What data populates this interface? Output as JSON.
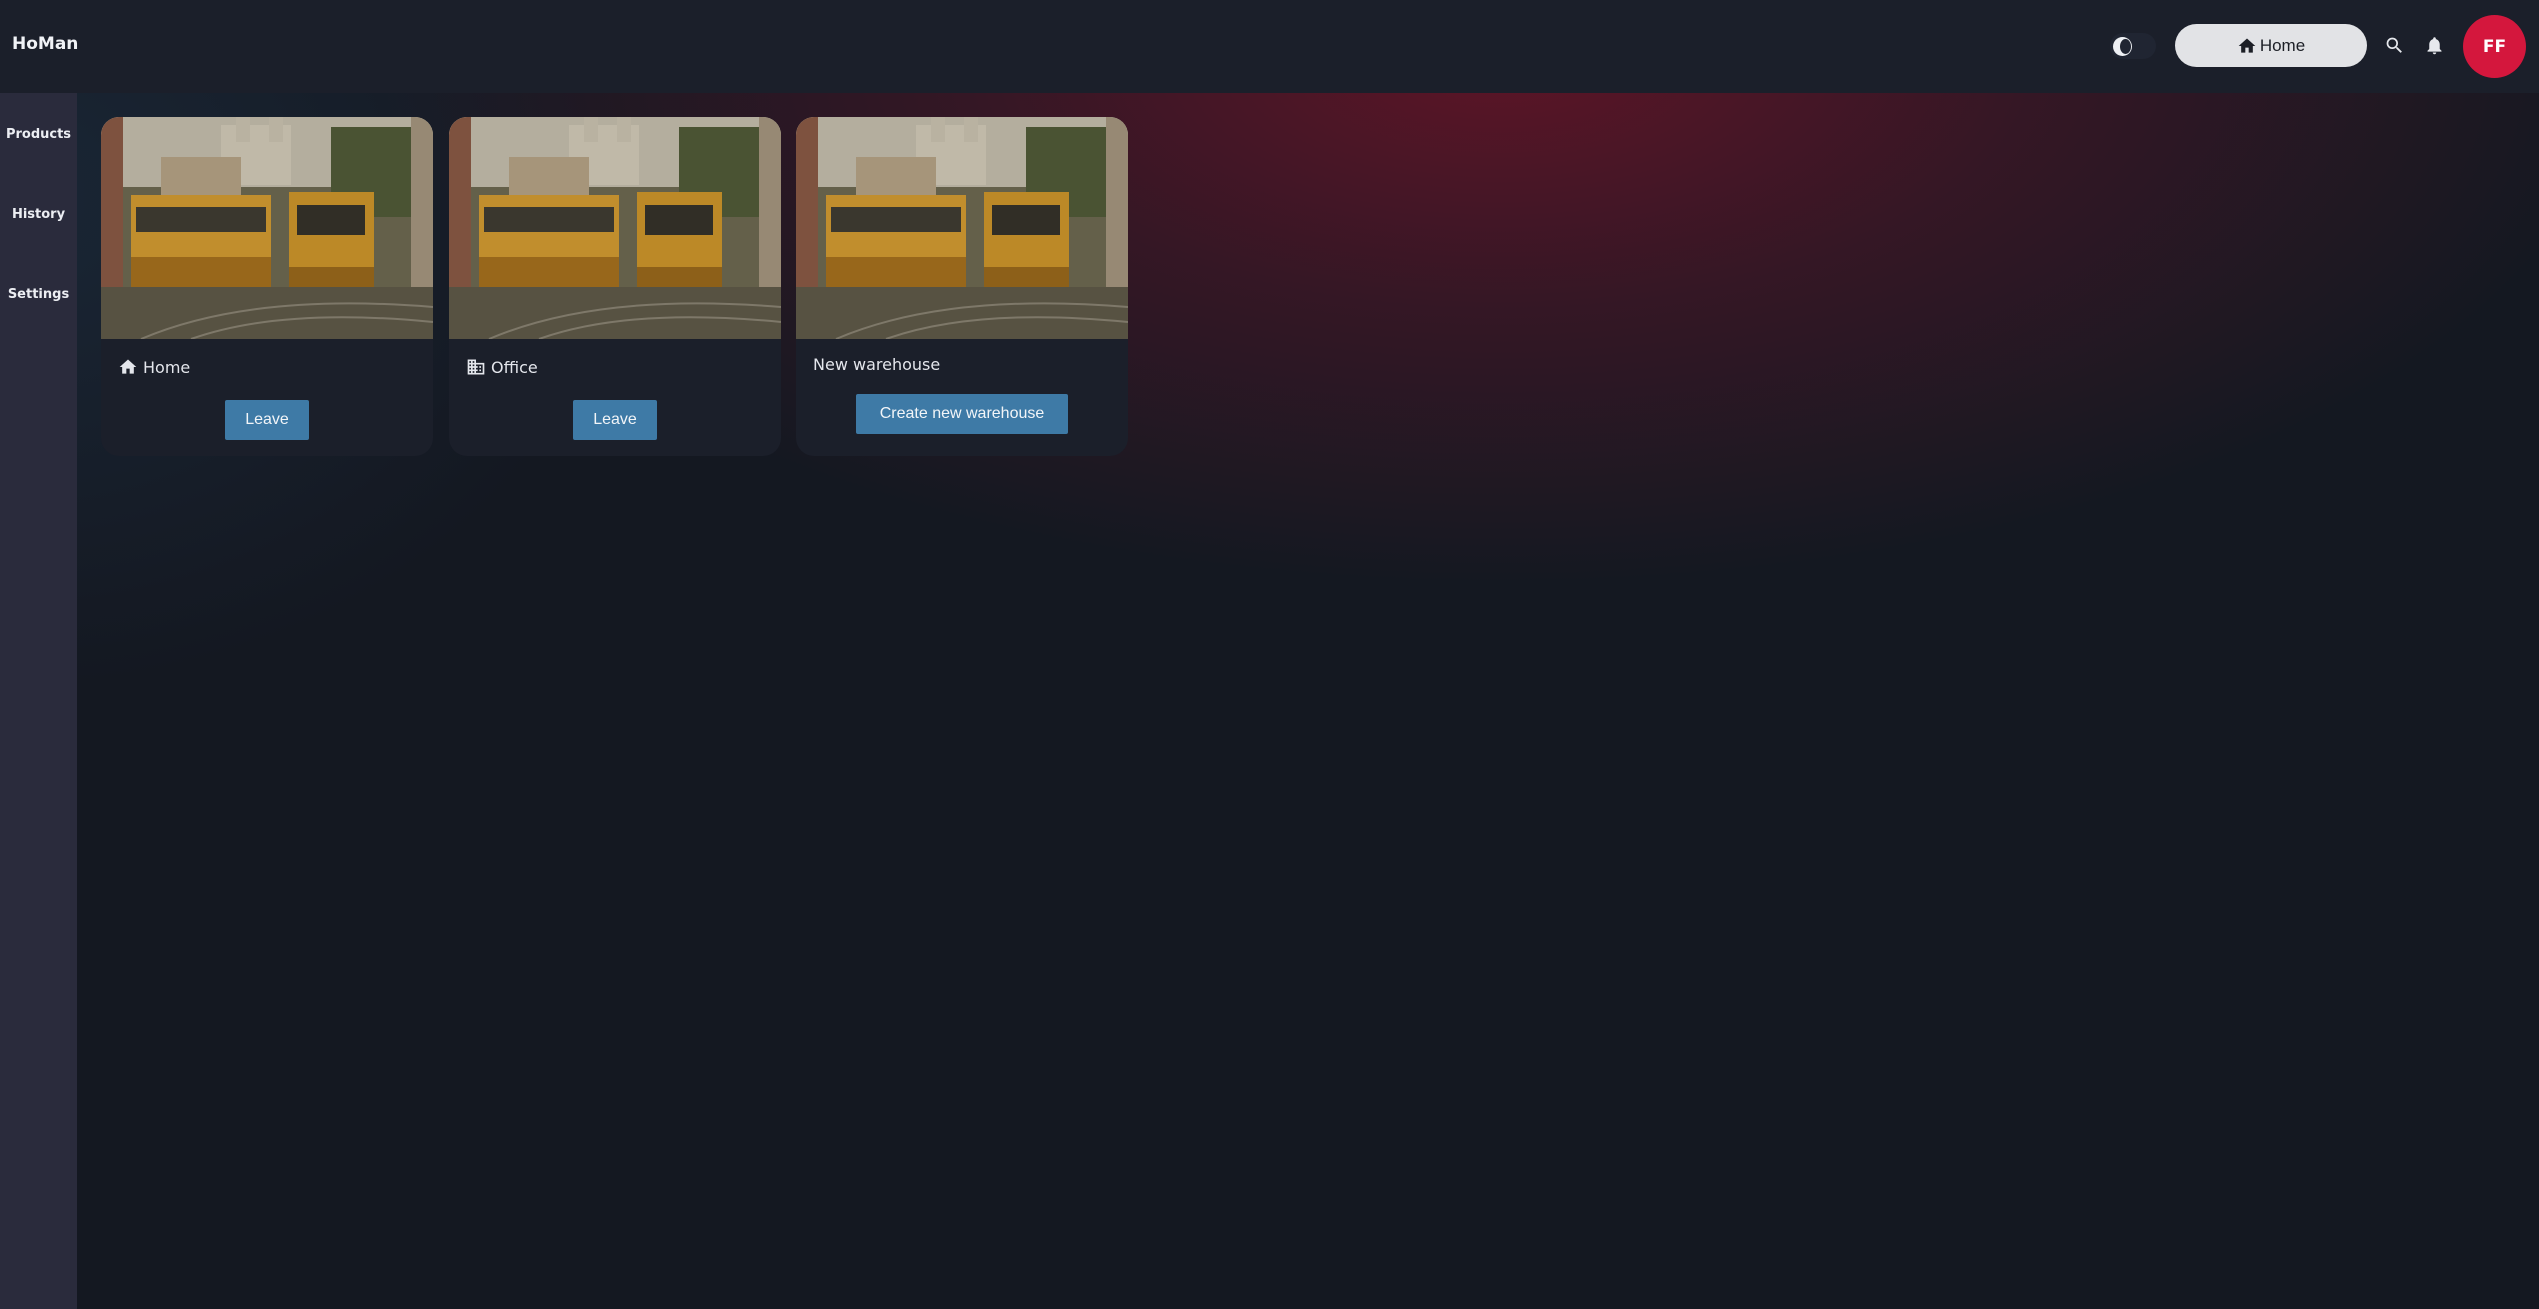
{
  "app": {
    "title": "HoMan"
  },
  "header": {
    "home_label": "Home",
    "avatar_initials": "FF",
    "icons": [
      "theme-toggle-icon",
      "home-icon",
      "search-icon",
      "bell-icon"
    ]
  },
  "sidebar": {
    "items": [
      {
        "label": "Products"
      },
      {
        "label": "History"
      },
      {
        "label": "Settings"
      }
    ]
  },
  "warehouses": [
    {
      "name": "Home",
      "icon": "home-icon",
      "button_label": "Leave"
    },
    {
      "name": "Office",
      "icon": "office-building-icon",
      "button_label": "Leave"
    },
    {
      "name": "New warehouse",
      "icon": "",
      "button_label": "Create new warehouse"
    }
  ],
  "colors": {
    "accent_button": "#3e7aa6",
    "avatar": "#d4173d",
    "topbar": "#1b1f2a",
    "sidebar": "#2a2b3c"
  }
}
